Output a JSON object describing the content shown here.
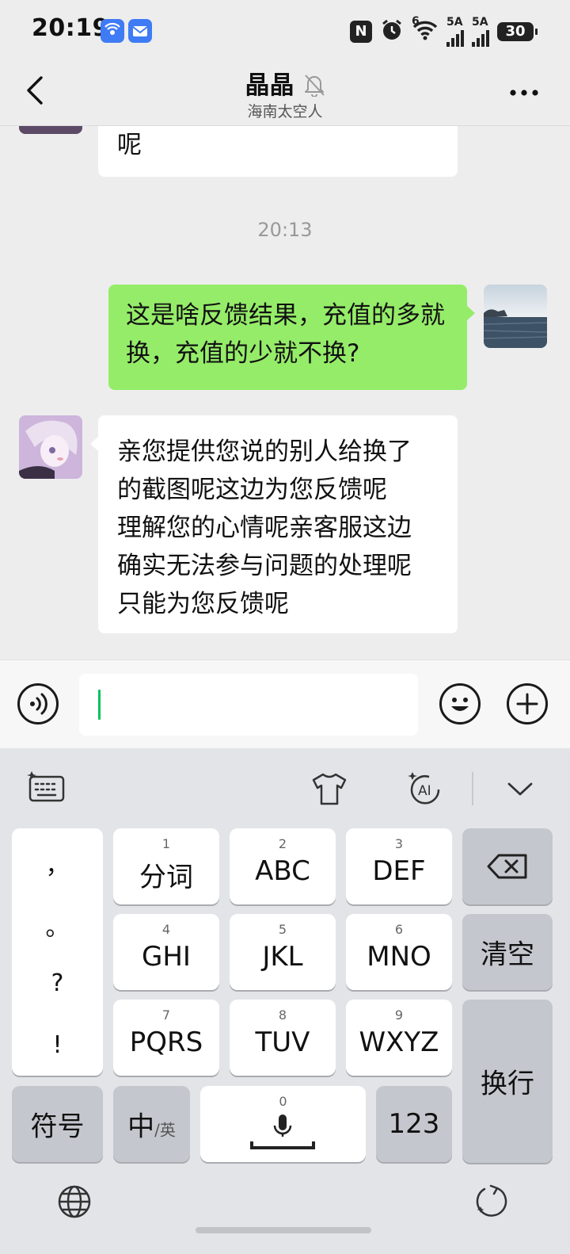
{
  "status_bar": {
    "time": "20:19",
    "nfc_label": "N",
    "signal1_label": "6",
    "signal2_label": "5A",
    "signal3_label": "5A",
    "battery": "30"
  },
  "header": {
    "title": "晶晶",
    "subtitle": "海南太空人"
  },
  "messages": {
    "prev_tail": "呢",
    "timestamp": "20:13",
    "sent": "这是啥反馈结果，充值的多就换，充值的少就不换?",
    "received_lines": [
      "亲您提供您说的别人给换了",
      "的截图呢这边为您反馈呢",
      "理解您的心情呢亲客服这边",
      "确实无法参与问题的处理呢",
      "只能为您反馈呢"
    ]
  },
  "input": {
    "value": ""
  },
  "keyboard": {
    "punctuation": [
      "，",
      "。",
      "?",
      "!"
    ],
    "keys": [
      {
        "num": "1",
        "label": "分词"
      },
      {
        "num": "2",
        "label": "ABC"
      },
      {
        "num": "3",
        "label": "DEF"
      },
      {
        "num": "4",
        "label": "GHI"
      },
      {
        "num": "5",
        "label": "JKL"
      },
      {
        "num": "6",
        "label": "MNO"
      },
      {
        "num": "7",
        "label": "PQRS"
      },
      {
        "num": "8",
        "label": "TUV"
      },
      {
        "num": "9",
        "label": "WXYZ"
      }
    ],
    "clear_label": "清空",
    "enter_label": "换行",
    "symbols_label": "符号",
    "lang_main": "中",
    "lang_sub": "/英",
    "space_num": "0",
    "numbers_label": "123"
  },
  "colors": {
    "sent_bubble": "#95ec69",
    "received_bubble": "#ffffff",
    "caret": "#07c160"
  }
}
